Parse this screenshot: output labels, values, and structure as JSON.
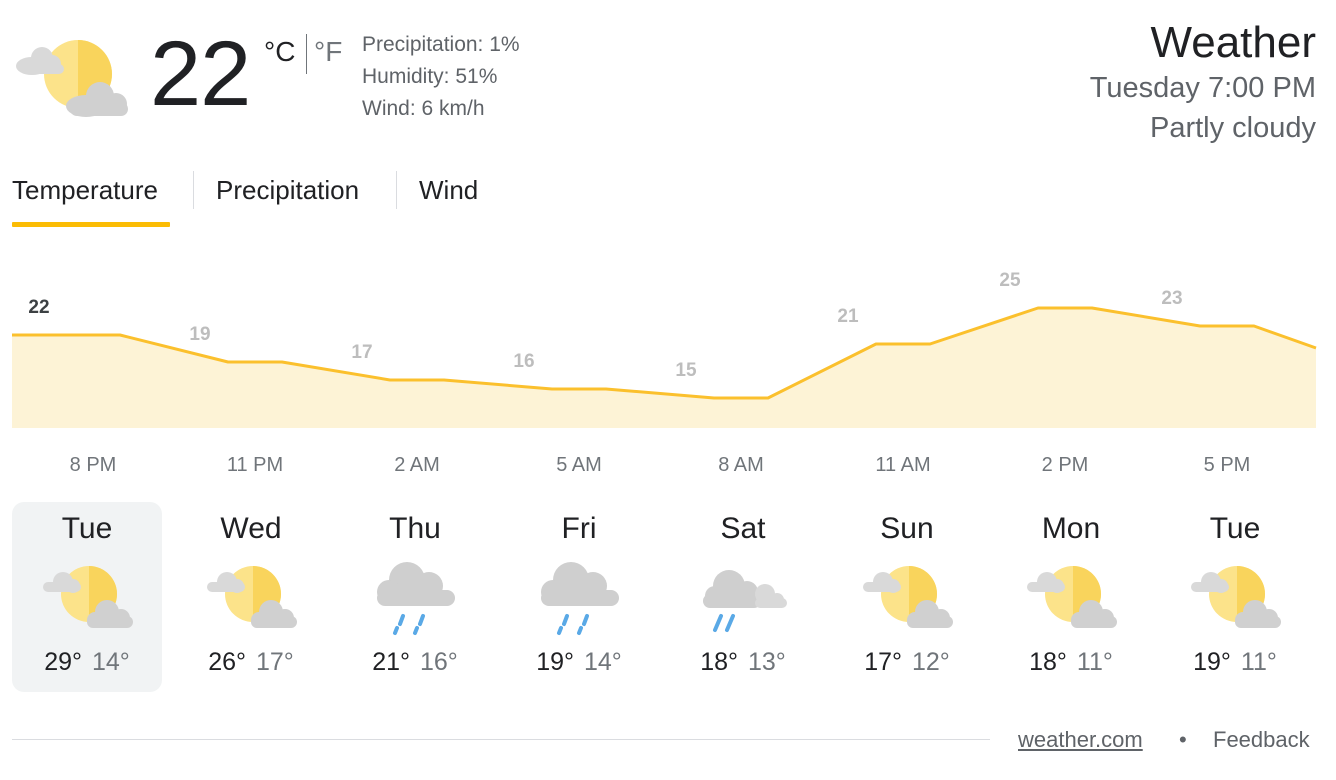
{
  "current": {
    "temp": "22",
    "unit_c": "°C",
    "unit_f": "°F",
    "precipitation": "Precipitation: 1%",
    "humidity": "Humidity: 51%",
    "wind": "Wind: 6 km/h",
    "icon": "partly-cloudy-icon"
  },
  "header": {
    "title": "Weather",
    "time": "Tuesday 7:00 PM",
    "condition": "Partly cloudy"
  },
  "tabs": [
    {
      "label": "Temperature",
      "active": true
    },
    {
      "label": "Precipitation",
      "active": false
    },
    {
      "label": "Wind",
      "active": false
    }
  ],
  "chart_data": {
    "type": "area",
    "temperatures": [
      22,
      19,
      17,
      16,
      15,
      21,
      25,
      23
    ],
    "hours": [
      "8 PM",
      "11 PM",
      "2 AM",
      "5 AM",
      "8 AM",
      "11 AM",
      "2 PM",
      "5 PM"
    ],
    "line_color": "#fbc02d",
    "fill_color": "#fdf3d6"
  },
  "days": [
    {
      "name": "Tue",
      "hi": "29°",
      "lo": "14°",
      "icon": "partly-cloudy-icon",
      "selected": true
    },
    {
      "name": "Wed",
      "hi": "26°",
      "lo": "17°",
      "icon": "partly-cloudy-icon",
      "selected": false
    },
    {
      "name": "Thu",
      "hi": "21°",
      "lo": "16°",
      "icon": "rain-icon",
      "selected": false
    },
    {
      "name": "Fri",
      "hi": "19°",
      "lo": "14°",
      "icon": "rain-icon",
      "selected": false
    },
    {
      "name": "Sat",
      "hi": "18°",
      "lo": "13°",
      "icon": "scattered-showers-icon",
      "selected": false
    },
    {
      "name": "Sun",
      "hi": "17°",
      "lo": "12°",
      "icon": "partly-cloudy-icon",
      "selected": false
    },
    {
      "name": "Mon",
      "hi": "18°",
      "lo": "11°",
      "icon": "partly-cloudy-icon",
      "selected": false
    },
    {
      "name": "Tue",
      "hi": "19°",
      "lo": "11°",
      "icon": "partly-cloudy-icon",
      "selected": false
    }
  ],
  "footer": {
    "source": "weather.com",
    "separator": "•",
    "feedback": "Feedback"
  }
}
